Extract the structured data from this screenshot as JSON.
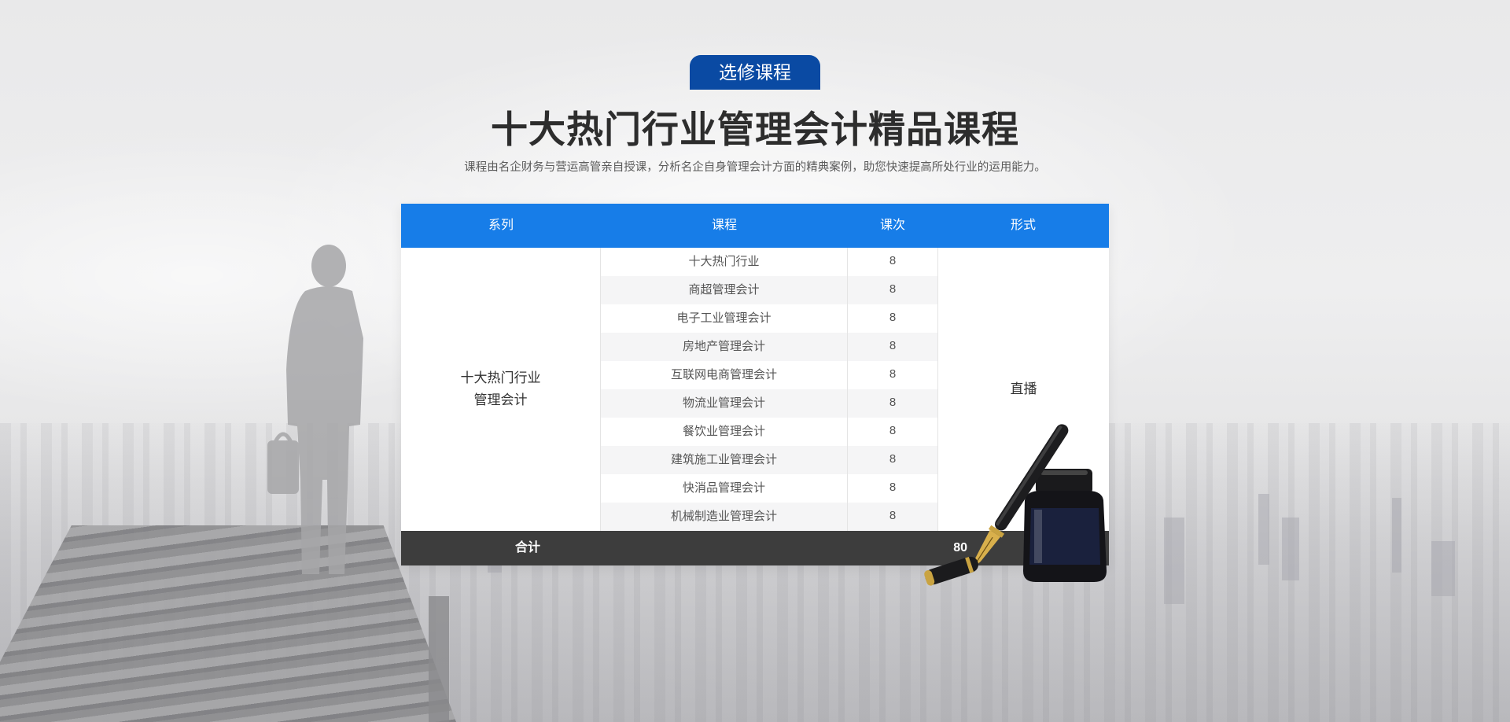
{
  "header": {
    "badge": "选修课程",
    "title": "十大热门行业管理会计精品课程",
    "subtitle": "课程由名企财务与营运高管亲自授课，分析名企自身管理会计方面的精典案例，助您快速提高所处行业的运用能力。"
  },
  "table": {
    "headers": [
      "系列",
      "课程",
      "课次",
      "形式"
    ],
    "series_line1": "十大热门行业",
    "series_line2": "管理会计",
    "form": "直播",
    "rows": [
      {
        "course": "十大热门行业",
        "sessions": "8"
      },
      {
        "course": "商超管理会计",
        "sessions": "8"
      },
      {
        "course": "电子工业管理会计",
        "sessions": "8"
      },
      {
        "course": "房地产管理会计",
        "sessions": "8"
      },
      {
        "course": "互联网电商管理会计",
        "sessions": "8"
      },
      {
        "course": "物流业管理会计",
        "sessions": "8"
      },
      {
        "course": "餐饮业管理会计",
        "sessions": "8"
      },
      {
        "course": "建筑施工业管理会计",
        "sessions": "8"
      },
      {
        "course": "快消品管理会计",
        "sessions": "8"
      },
      {
        "course": "机械制造业管理会计",
        "sessions": "8"
      }
    ],
    "total_label": "合计",
    "total_value": "80"
  },
  "colors": {
    "badge": "#0a4aa3",
    "table_header": "#177de8",
    "table_footer": "#3d3d3d"
  },
  "icons": [
    "businessman-silhouette",
    "fountain-pen-ink-bottle"
  ]
}
